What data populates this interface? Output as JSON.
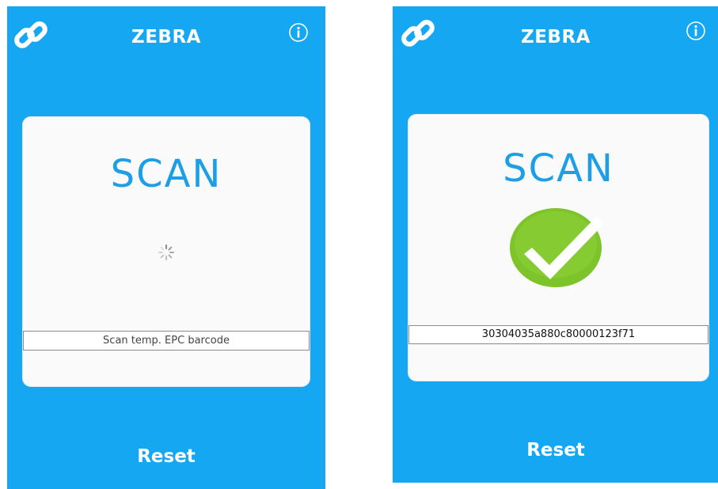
{
  "colors": {
    "background": "#16a7f2",
    "card": "#fafafa",
    "scan_text": "#1c9fe6",
    "success_green": "#7cc42a"
  },
  "left_screen": {
    "brand": "ZEBRA",
    "scan_title": "SCAN",
    "status_text": "Scan temp. EPC barcode",
    "reset_label": "Reset",
    "state": "scanning",
    "icons": [
      "link-icon",
      "info-icon",
      "spinner-icon"
    ]
  },
  "right_screen": {
    "brand": "ZEBRA",
    "scan_title": "SCAN",
    "status_text": "30304035a880c80000123f71",
    "reset_label": "Reset",
    "state": "success",
    "icons": [
      "link-icon",
      "info-icon",
      "checkmark-icon"
    ]
  }
}
